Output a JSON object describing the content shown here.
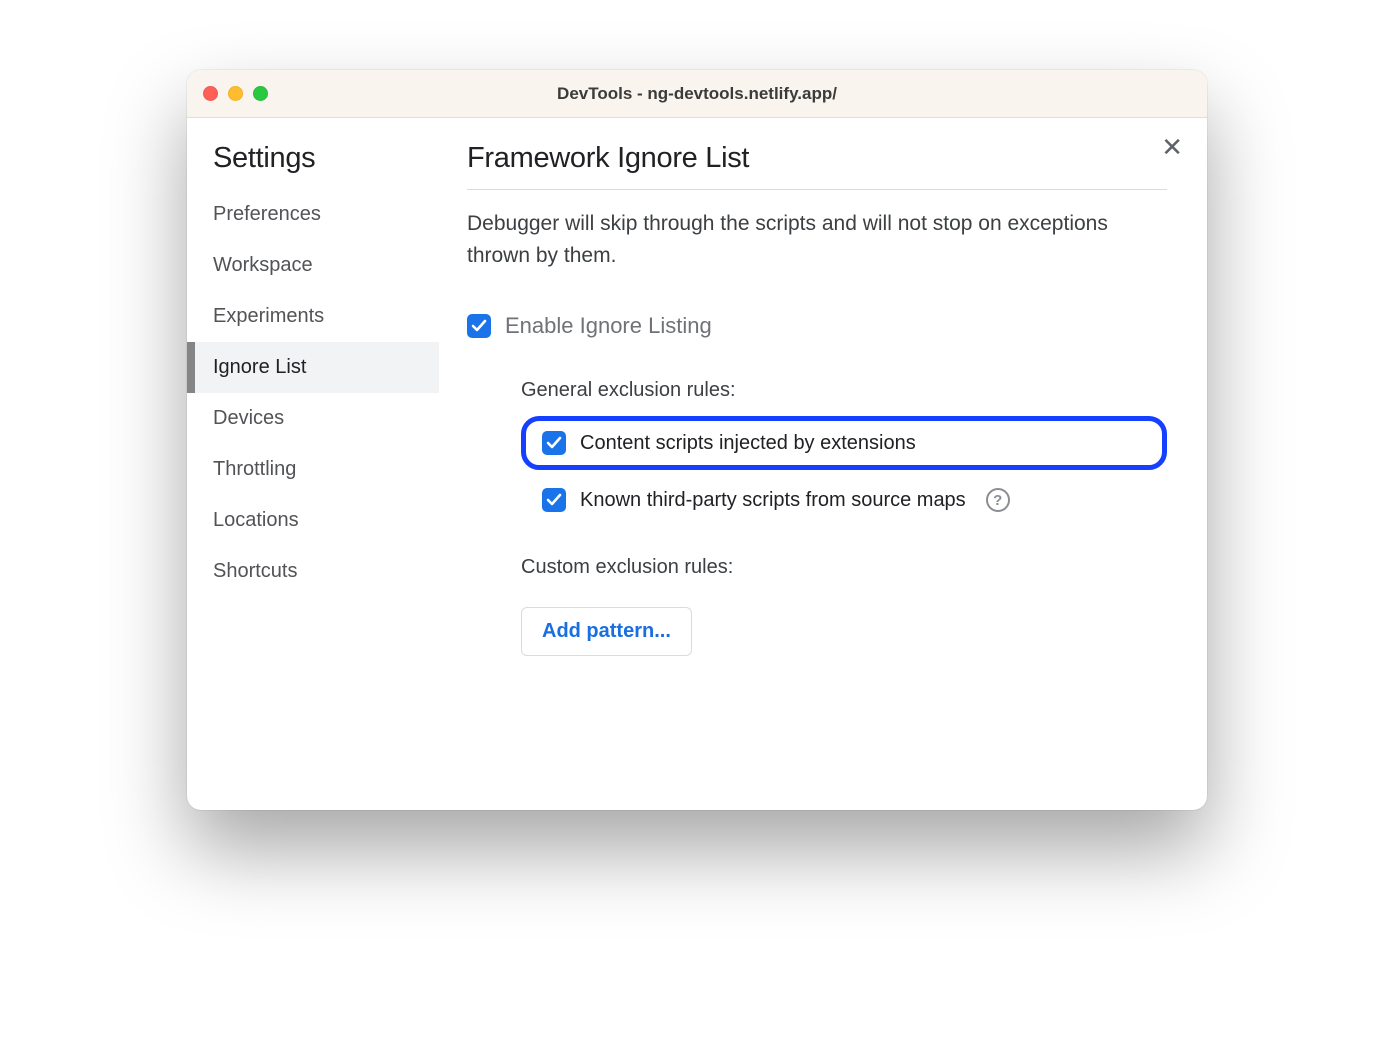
{
  "window": {
    "title": "DevTools - ng-devtools.netlify.app/"
  },
  "close_label": "✕",
  "sidebar": {
    "title": "Settings",
    "items": [
      {
        "label": "Preferences",
        "active": false
      },
      {
        "label": "Workspace",
        "active": false
      },
      {
        "label": "Experiments",
        "active": false
      },
      {
        "label": "Ignore List",
        "active": true
      },
      {
        "label": "Devices",
        "active": false
      },
      {
        "label": "Throttling",
        "active": false
      },
      {
        "label": "Locations",
        "active": false
      },
      {
        "label": "Shortcuts",
        "active": false
      }
    ]
  },
  "main": {
    "title": "Framework Ignore List",
    "description": "Debugger will skip through the scripts and will not stop on exceptions thrown by them.",
    "enable": {
      "checked": true,
      "label": "Enable Ignore Listing"
    },
    "general_rules_heading": "General exclusion rules:",
    "rules": [
      {
        "checked": true,
        "label": "Content scripts injected by extensions",
        "highlighted": true,
        "help": false
      },
      {
        "checked": true,
        "label": "Known third-party scripts from source maps",
        "highlighted": false,
        "help": true
      }
    ],
    "custom_rules_heading": "Custom exclusion rules:",
    "add_pattern_label": "Add pattern...",
    "help_glyph": "?"
  },
  "colors": {
    "accent": "#1a73e8",
    "highlight_border": "#1540ff"
  }
}
